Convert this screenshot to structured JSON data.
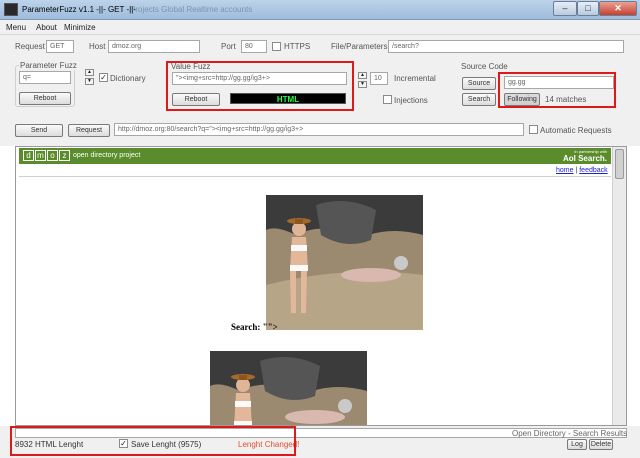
{
  "window": {
    "title": "ParameterFuzz v1.1  -||-  GET  -||-",
    "ghost_text": "Projects    Global    Realtime accounts",
    "min_label": "–",
    "max_label": "□",
    "close_label": "✕"
  },
  "menu": [
    "Menu",
    "About",
    "Minimize"
  ],
  "request": {
    "request_label": "Request",
    "method_value": "GET",
    "host_label": "Host",
    "host_value": "dmoz.org",
    "port_label": "Port",
    "port_value": "80",
    "https_label": "HTTPS",
    "https_checked": false,
    "file_label": "File/Parameters:",
    "file_value": "/search?"
  },
  "param_fuzz": {
    "group_label": "Parameter Fuzz",
    "value": "q=",
    "dictionary_label": "Dictionary",
    "dictionary_checked": true,
    "reboot_label": "Reboot"
  },
  "value_fuzz": {
    "group_label": "Value Fuzz",
    "value": "\"><img+src=http://gg.gg/ig3+>",
    "reboot_label": "Reboot",
    "status_text": "HTML",
    "count_value": "10",
    "incremental_label": "Incremental",
    "injections_label": "Injections",
    "injections_checked": false
  },
  "source_code": {
    "group_label": "Source Code",
    "source_button": "Source",
    "search_button": "Search",
    "search_value": "gg.gg",
    "following_button": "Following",
    "matches_text": "14 matches"
  },
  "send_row": {
    "send_label": "Send",
    "request_label": "Request",
    "url_value": "http://dmoz.org:80/search?q=\"><img+src=http://gg.gg/ig3+>",
    "auto_label": "Automatic Requests",
    "auto_checked": false
  },
  "browser": {
    "logo_letters": [
      "d",
      "m",
      "o",
      "z"
    ],
    "tagline": "open directory project",
    "partner_small": "In partnership with",
    "partner_big": "Aol Search.",
    "home_link": "home",
    "separator": " | ",
    "feedback_link": "feedback",
    "search_label": "Search: \"\">"
  },
  "status": {
    "page_title": "Open Directory - Search Results",
    "html_length": "8932 HTML Lenght",
    "save_length_label": "Save Lenght (9575)",
    "save_length_checked": true,
    "length_changed": "Lenght Changed!",
    "log_button": "Log",
    "delete_button": "Delete"
  },
  "colors": {
    "highlight": "#e01818",
    "dmoz_green": "#5b8c2c",
    "status_green": "#22ff44",
    "length_changed": "#e05030"
  }
}
